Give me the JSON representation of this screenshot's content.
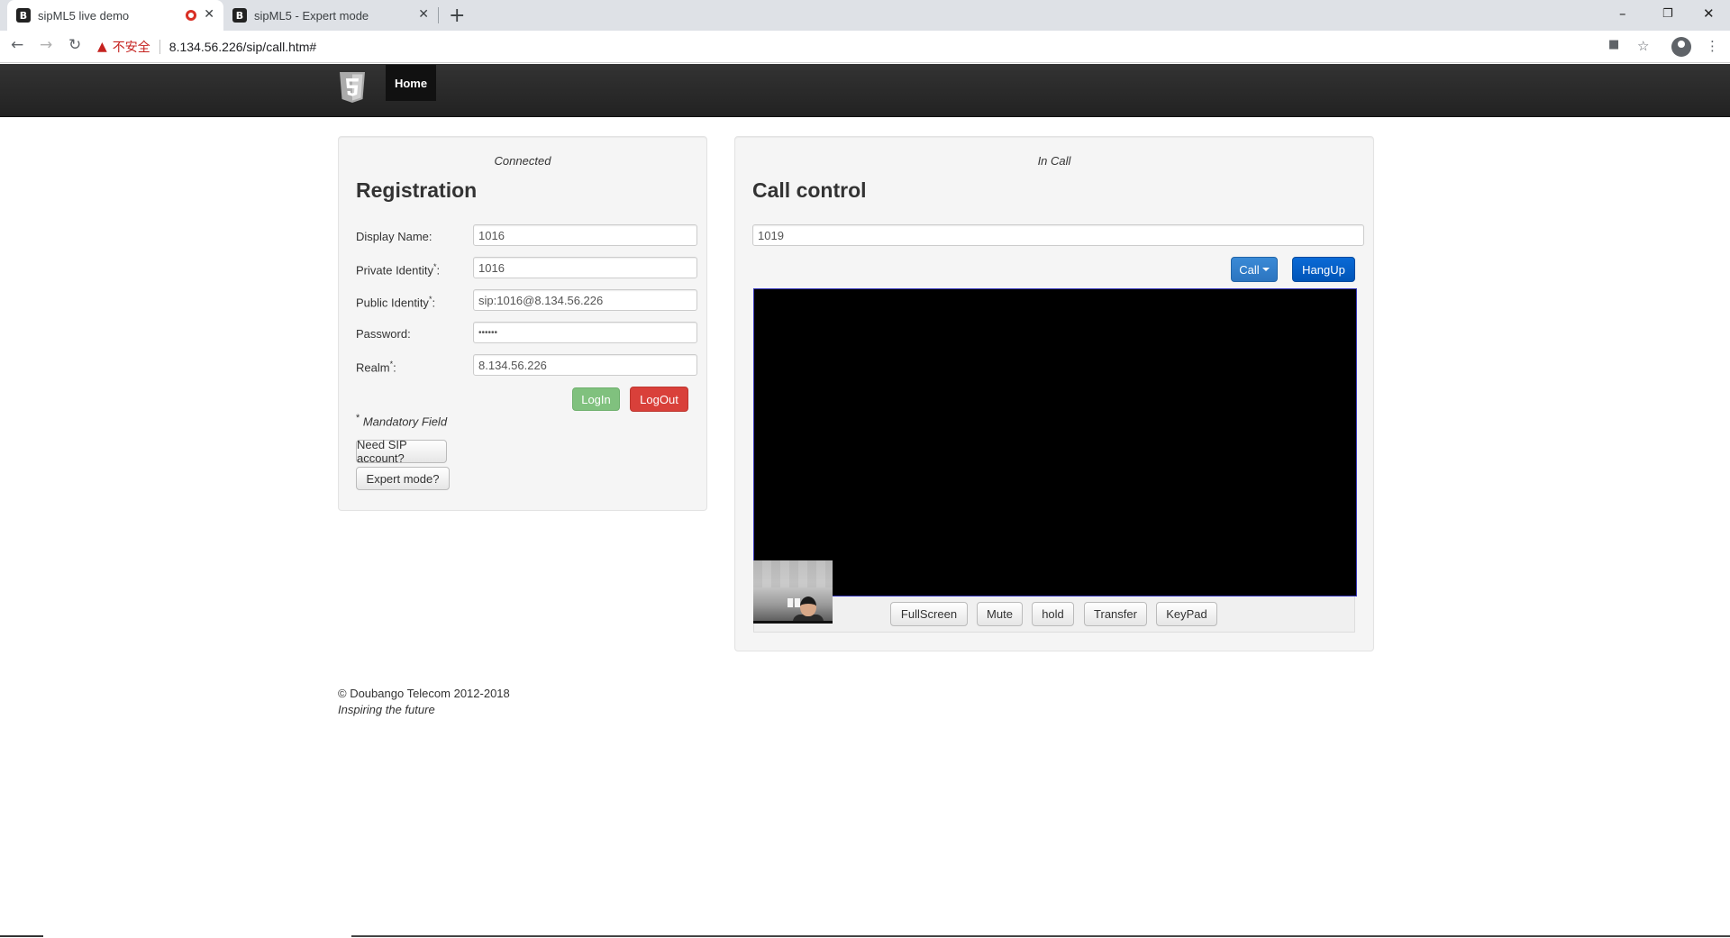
{
  "browser": {
    "tabs": [
      {
        "title": "sipML5 live demo",
        "favicon": "B",
        "recording": true,
        "active": true
      },
      {
        "title": "sipML5 - Expert mode",
        "favicon": "B",
        "recording": false,
        "active": false
      }
    ],
    "security_warning": "不安全",
    "url": "8.134.56.226/sip/call.htm#"
  },
  "navbar": {
    "home_label": "Home"
  },
  "registration": {
    "status": "Connected",
    "title": "Registration",
    "fields": [
      {
        "label": "Display Name:",
        "value": "1016",
        "mandatory": false
      },
      {
        "label": "Private Identity",
        "value": "1016",
        "mandatory": true
      },
      {
        "label": "Public Identity",
        "value": "sip:1016@8.134.56.226",
        "mandatory": true
      },
      {
        "label": "Password:",
        "value": "••••••",
        "mandatory": false
      },
      {
        "label": "Realm",
        "value": "8.134.56.226",
        "mandatory": true
      }
    ],
    "mandatory_star": "*",
    "mandatory_colon": ":",
    "login_label": "LogIn",
    "logout_label": "LogOut",
    "mandatory_note": "Mandatory Field",
    "need_account_label": "Need SIP account?",
    "expert_mode_label": "Expert mode?"
  },
  "call_control": {
    "status": "In Call",
    "title": "Call control",
    "number": "1019",
    "call_label": "Call",
    "hangup_label": "HangUp",
    "buttons": [
      "FullScreen",
      "Mute",
      "hold",
      "Transfer",
      "KeyPad"
    ]
  },
  "footer": {
    "copyright": "© Doubango Telecom 2012-2018",
    "tagline": "Inspiring the future"
  },
  "colors": {
    "navbar": "#222222",
    "login": "#80c17e",
    "logout": "#d9403a",
    "call": "#3a8ad6",
    "hangup": "#0a6ad6",
    "video_bg": "#000000"
  }
}
